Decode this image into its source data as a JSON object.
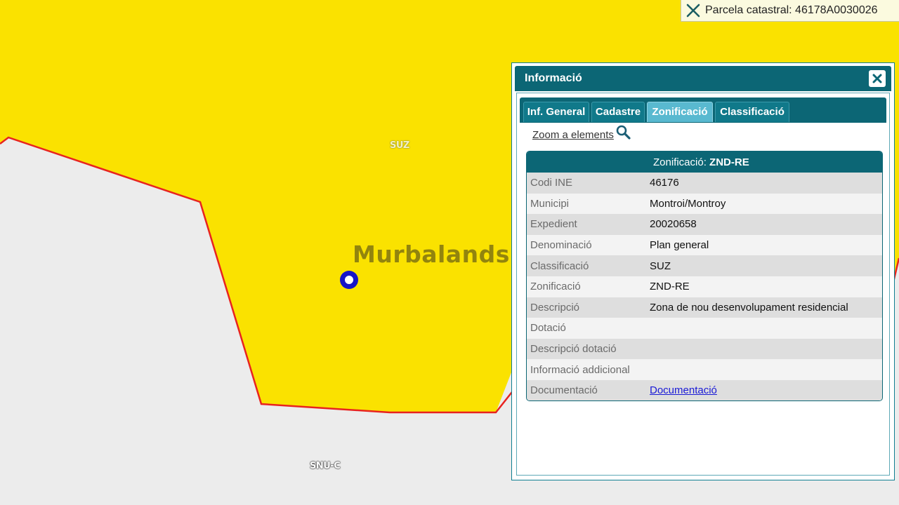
{
  "map": {
    "zone_label_top": "SUZ",
    "zone_label_bottom": "SNU-C",
    "watermark": "Murbalands ®",
    "colors": {
      "zone_fill": "#fae200",
      "zone_border": "#e8231f",
      "marker": "#1614c8"
    }
  },
  "parcel_bar": {
    "close_icon": "close-x-icon",
    "text": "Parcela catastral: 46178A0030026"
  },
  "panel": {
    "title": "Informació",
    "close_icon": "close-icon",
    "tabs": [
      {
        "label": "Inf. General",
        "active": false
      },
      {
        "label": "Cadastre",
        "active": false
      },
      {
        "label": "Zonificació",
        "active": true
      },
      {
        "label": "Classificació",
        "active": false
      }
    ],
    "zoom_link": "Zoom a elements",
    "zoom_icon": "magnifier-icon",
    "table": {
      "header_prefix": "Zonificació: ",
      "header_value": "ZND-RE",
      "rows": [
        {
          "key": "Codi INE",
          "value": "46176"
        },
        {
          "key": "Municipi",
          "value": "Montroi/Montroy"
        },
        {
          "key": "Expedient",
          "value": "20020658"
        },
        {
          "key": "Denominació",
          "value": "Plan general"
        },
        {
          "key": "Classificació",
          "value": "SUZ"
        },
        {
          "key": "Zonificació",
          "value": "ZND-RE"
        },
        {
          "key": "Descripció",
          "value": "Zona de nou desenvolupament residencial"
        },
        {
          "key": "Dotació",
          "value": ""
        },
        {
          "key": "Descripció dotació",
          "value": ""
        },
        {
          "key": "Informació addicional",
          "value": ""
        },
        {
          "key": "Documentació",
          "value": "Documentació",
          "link": true
        }
      ]
    }
  }
}
